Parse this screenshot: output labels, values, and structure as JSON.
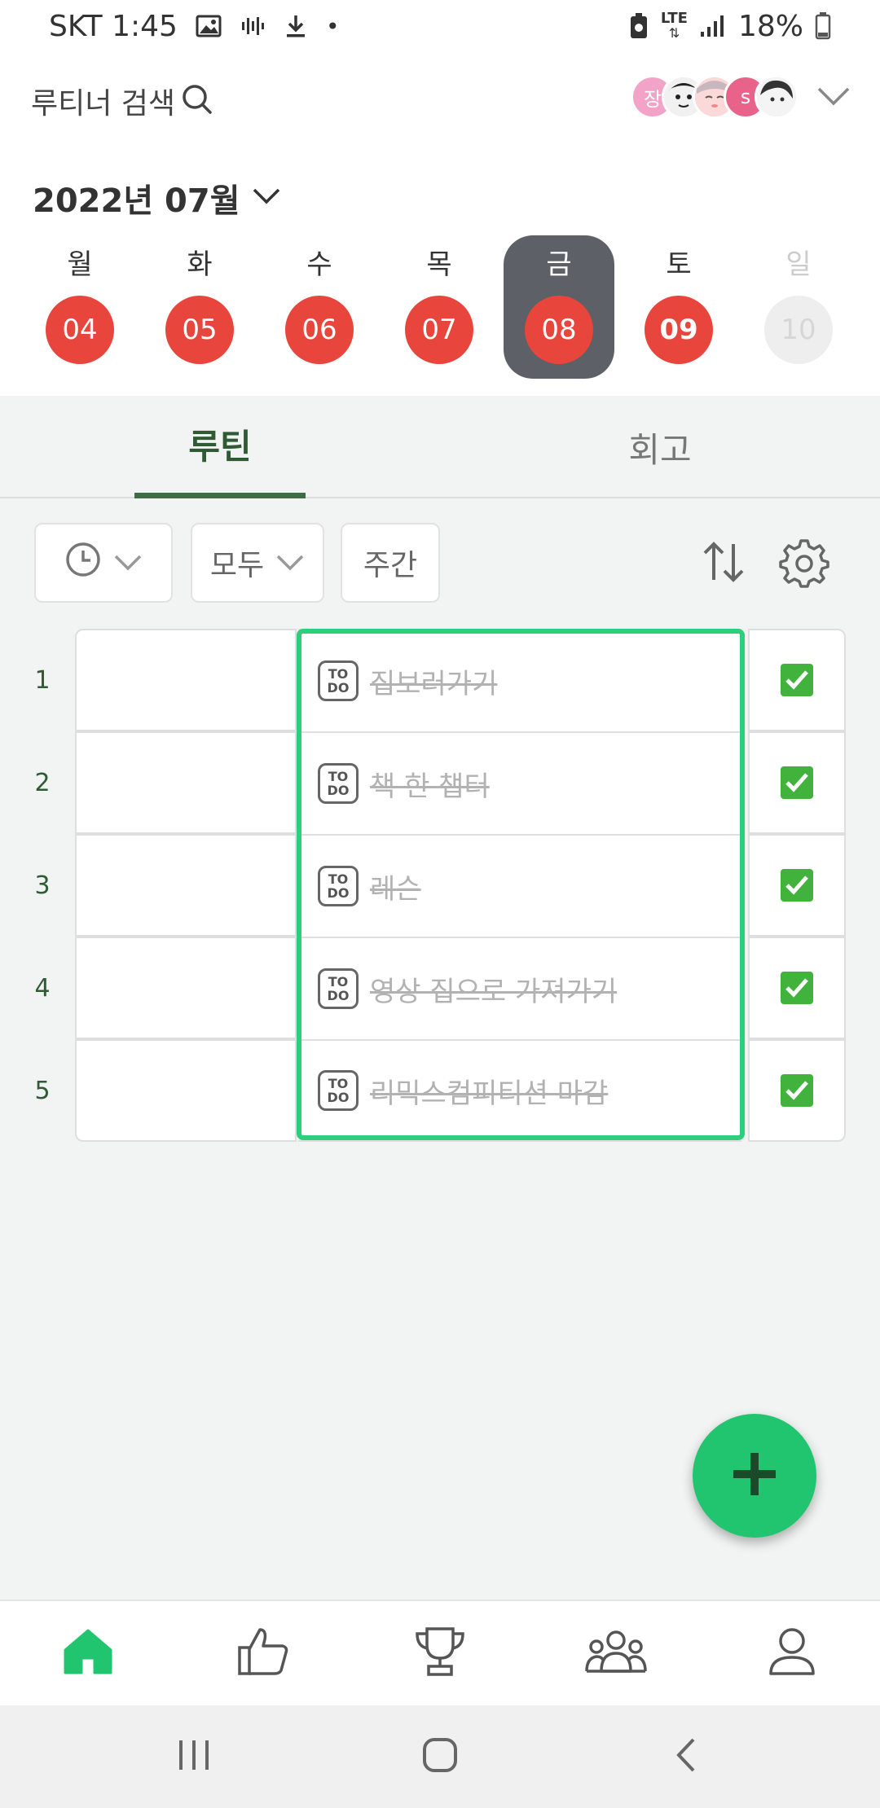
{
  "status_bar": {
    "carrier_time": "SKT 1:45",
    "dot": "•",
    "network": "LTE",
    "battery": "18%"
  },
  "header": {
    "search_label": "루티너 검색",
    "avatars": [
      {
        "label": "장",
        "color": "#f4a3c8"
      },
      {
        "label": "",
        "color": "#d9d9d9"
      },
      {
        "label": "",
        "color": "#f7c7c9"
      },
      {
        "label": "s",
        "color": "#e9628a"
      },
      {
        "label": "",
        "color": "#cfcfcf"
      }
    ],
    "month_label": "2022년 07월"
  },
  "week": [
    {
      "name": "월",
      "num": "04",
      "selected": false,
      "faded": false
    },
    {
      "name": "화",
      "num": "05",
      "selected": false,
      "faded": false
    },
    {
      "name": "수",
      "num": "06",
      "selected": false,
      "faded": false
    },
    {
      "name": "목",
      "num": "07",
      "selected": false,
      "faded": false
    },
    {
      "name": "금",
      "num": "08",
      "selected": true,
      "faded": false
    },
    {
      "name": "토",
      "num": "09",
      "selected": false,
      "faded": false
    },
    {
      "name": "일",
      "num": "10",
      "selected": false,
      "faded": true
    }
  ],
  "tabs": {
    "routine": "루틴",
    "review": "회고"
  },
  "filters": {
    "all": "모두",
    "weekly": "주간"
  },
  "routines": [
    {
      "num": "1",
      "title": "집보러가기",
      "badge_top": "TO",
      "badge_bottom": "DO",
      "done": true
    },
    {
      "num": "2",
      "title": "책 한 챕터",
      "badge_top": "TO",
      "badge_bottom": "DO",
      "done": true
    },
    {
      "num": "3",
      "title": "레슨",
      "badge_top": "TO",
      "badge_bottom": "DO",
      "done": true
    },
    {
      "num": "4",
      "title": "영상 집으로 가져가기",
      "badge_top": "TO",
      "badge_bottom": "DO",
      "done": true
    },
    {
      "num": "5",
      "title": "리믹스컴피티션 마감",
      "badge_top": "TO",
      "badge_bottom": "DO",
      "done": true
    }
  ],
  "colors": {
    "accent_green": "#22c56f",
    "date_red": "#e8453c",
    "tab_green": "#2e5a34",
    "selected_day": "#5d6066"
  }
}
